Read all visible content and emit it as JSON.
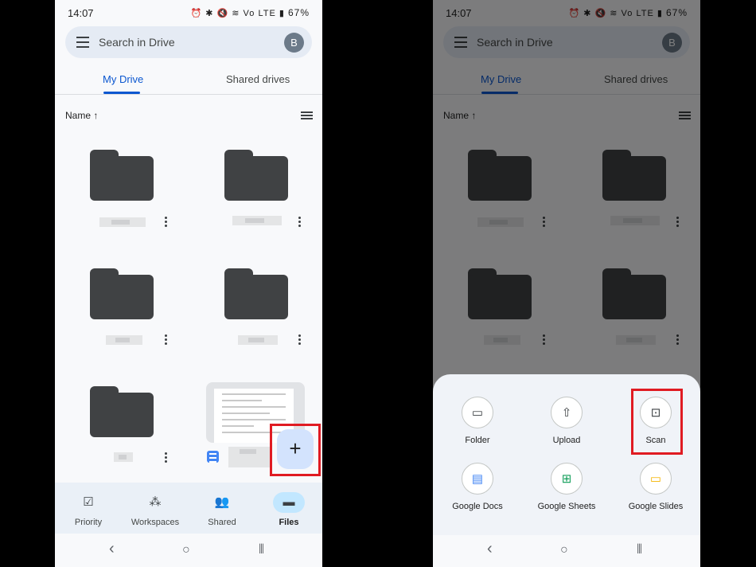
{
  "status": {
    "time": "14:07",
    "icons": "⏰ ✱ 🔇 ≋ Vo LTE ▮",
    "battery": "67%"
  },
  "search": {
    "placeholder": "Search in Drive",
    "avatar": "B"
  },
  "tabs": [
    {
      "label": "My Drive",
      "active": true
    },
    {
      "label": "Shared drives",
      "active": false
    }
  ],
  "sort": {
    "label": "Name",
    "arrow": "↑"
  },
  "fab": {
    "label": "+"
  },
  "bottom_nav": [
    {
      "label": "Priority",
      "icon": "priority-check-icon",
      "glyph": "☑"
    },
    {
      "label": "Workspaces",
      "icon": "workspaces-icon",
      "glyph": "⁂"
    },
    {
      "label": "Shared",
      "icon": "shared-people-icon",
      "glyph": "👥"
    },
    {
      "label": "Files",
      "icon": "files-folder-icon",
      "glyph": "▬",
      "active": true
    }
  ],
  "system_nav": {
    "back": "‹",
    "home": "○",
    "recents": "⦀"
  },
  "create_sheet": {
    "options": [
      {
        "label": "Folder",
        "icon": "folder-outline-icon",
        "glyph": "▭"
      },
      {
        "label": "Upload",
        "icon": "upload-icon",
        "glyph": "⇧"
      },
      {
        "label": "Scan",
        "icon": "scan-document-icon",
        "glyph": "⊡"
      },
      {
        "label": "Google Docs",
        "icon": "google-docs-icon",
        "glyph": "▤",
        "color": "#4285f4"
      },
      {
        "label": "Google Sheets",
        "icon": "google-sheets-icon",
        "glyph": "⊞",
        "color": "#0f9d58"
      },
      {
        "label": "Google Slides",
        "icon": "google-slides-icon",
        "glyph": "▭",
        "color": "#f4b400"
      }
    ]
  },
  "colors": {
    "accent": "#0b57d0",
    "highlight": "#e01b22",
    "folder": "#404244"
  }
}
